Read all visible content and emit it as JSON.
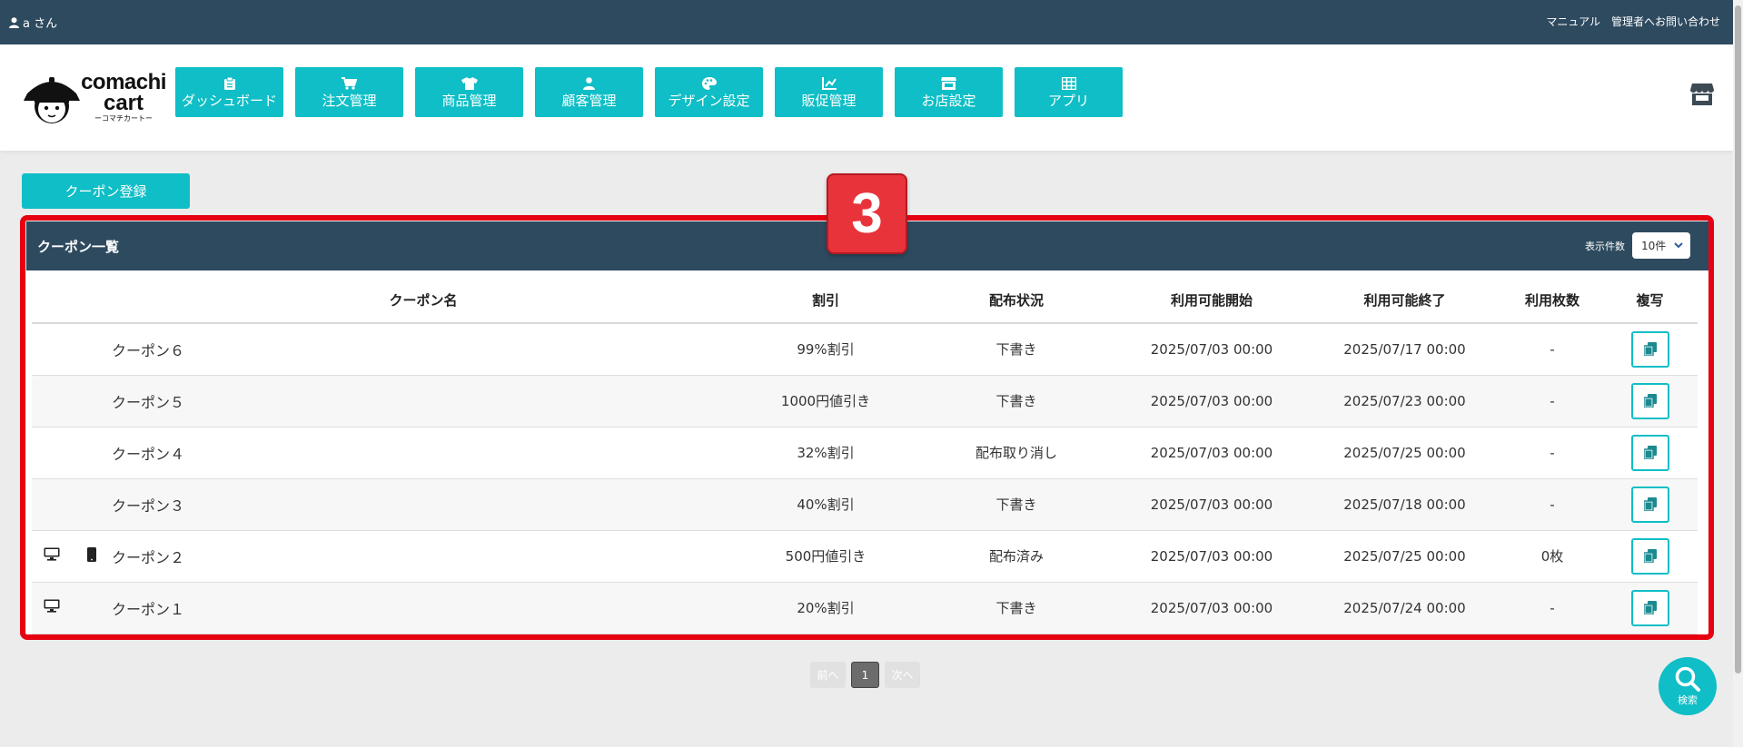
{
  "topbar": {
    "user_label": "a さん",
    "links": [
      "マニュアル",
      "管理者へお問い合わせ"
    ]
  },
  "logo": {
    "line1": "comachi",
    "line2": "cart",
    "line3": "ーコマチカートー"
  },
  "nav": [
    {
      "label": "ダッシュボード",
      "icon": "clipboard-icon"
    },
    {
      "label": "注文管理",
      "icon": "cart-icon"
    },
    {
      "label": "商品管理",
      "icon": "tshirt-icon"
    },
    {
      "label": "顧客管理",
      "icon": "user-icon"
    },
    {
      "label": "デザイン設定",
      "icon": "palette-icon"
    },
    {
      "label": "販促管理",
      "icon": "chart-icon"
    },
    {
      "label": "お店設定",
      "icon": "store-icon"
    },
    {
      "label": "アプリ",
      "icon": "grid-icon"
    }
  ],
  "register_button": "クーポン登録",
  "step_badge": "3",
  "list": {
    "title": "クーポン一覧",
    "perpage_label": "表示件数",
    "perpage_value": "10件",
    "headers": [
      "クーポン名",
      "割引",
      "配布状況",
      "利用可能開始",
      "利用可能終了",
      "利用枚数",
      "複写"
    ],
    "rows": [
      {
        "pc": false,
        "mobile": false,
        "name": "クーポン６",
        "discount": "99%割引",
        "status": "下書き",
        "start": "2025/07/03 00:00",
        "end": "2025/07/17 00:00",
        "used": "-"
      },
      {
        "pc": false,
        "mobile": false,
        "name": "クーポン５",
        "discount": "1000円値引き",
        "status": "下書き",
        "start": "2025/07/03 00:00",
        "end": "2025/07/23 00:00",
        "used": "-"
      },
      {
        "pc": false,
        "mobile": false,
        "name": "クーポン４",
        "discount": "32%割引",
        "status": "配布取り消し",
        "start": "2025/07/03 00:00",
        "end": "2025/07/25 00:00",
        "used": "-"
      },
      {
        "pc": false,
        "mobile": false,
        "name": "クーポン３",
        "discount": "40%割引",
        "status": "下書き",
        "start": "2025/07/03 00:00",
        "end": "2025/07/18 00:00",
        "used": "-"
      },
      {
        "pc": true,
        "mobile": true,
        "name": "クーポン２",
        "discount": "500円値引き",
        "status": "配布済み",
        "start": "2025/07/03 00:00",
        "end": "2025/07/25 00:00",
        "used": "0枚"
      },
      {
        "pc": true,
        "mobile": false,
        "name": "クーポン１",
        "discount": "20%割引",
        "status": "下書き",
        "start": "2025/07/03 00:00",
        "end": "2025/07/24 00:00",
        "used": "-"
      }
    ]
  },
  "pagination": {
    "prev": "前へ",
    "current": "1",
    "next": "次へ"
  },
  "search_fab": "検索",
  "colors": {
    "accent": "#0fbec6",
    "header_dark": "#2e4a5f",
    "highlight": "#e60012"
  }
}
